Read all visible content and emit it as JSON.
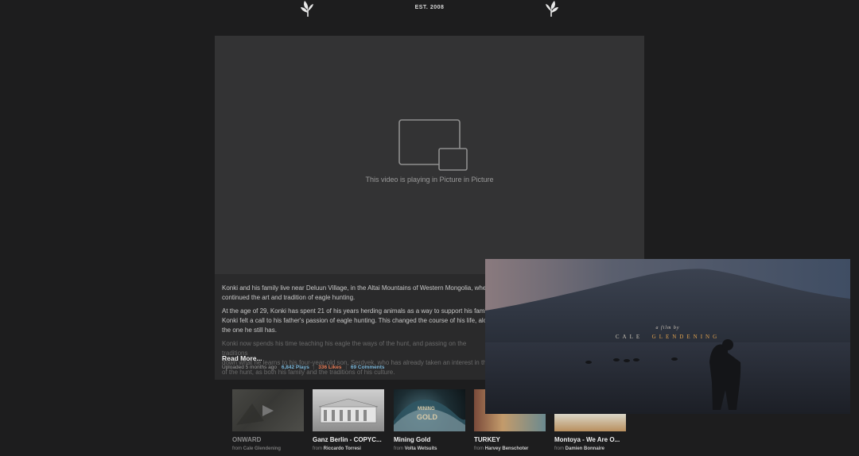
{
  "header": {
    "established": "EST. 2008",
    "logo_icon": "wheat-leaf-icon"
  },
  "player": {
    "pip_icon": "picture-in-picture-icon",
    "message": "This video is playing in Picture in Picture"
  },
  "description": {
    "paragraphs": [
      "Konki and his family live near Deluun Village, in the Altai Mountains of Western Mongolia, wher",
      "continued the art and tradition of eagle hunting.",
      "At the age of 29, Konki has spent 21 of his years herding animals as a way to support his famil",
      "Konki felt a call to his father's passion of eagle hunting. This changed the course of his life, alo",
      "the one he still has."
    ],
    "faded_lines": [
      "Konki now spends his time teaching his eagle the ways of the hunt, and passing on the traditions",
      "down what he learns to his four-year-old son, Serdyek, who has already taken an interest in th",
      "of the hunt, as both his family and the traditions of his culture."
    ],
    "read_more": "Read More...",
    "uploaded": "Uploaded 5 months ago",
    "plays": "6,842 Plays",
    "likes": "336 Likes",
    "comments": "69 Comments",
    "separator": "|"
  },
  "related": [
    {
      "title": "ONWARD",
      "from_prefix": "from",
      "author": "Cale Glendening",
      "dim": true
    },
    {
      "title": "Ganz Berlin - COPYC...",
      "from_prefix": "from",
      "author": "Riccardo Torresi",
      "dim": false
    },
    {
      "title": "Mining Gold",
      "from_prefix": "from",
      "author": "Volta Wetsuits",
      "dim": false,
      "thumb_text_1": "MINING",
      "thumb_text_2": "GOLD"
    },
    {
      "title": "TURKEY",
      "from_prefix": "from",
      "author": "Harvey Benschoter",
      "dim": false
    },
    {
      "title": "Montoya - We Are O...",
      "from_prefix": "from",
      "author": "Damien Bonnaire",
      "dim": false
    }
  ],
  "pip_window": {
    "credit_small": "a film by",
    "credit_first": "CALE",
    "credit_last": "GLENDENING",
    "accent_color": "#e1a24f"
  }
}
